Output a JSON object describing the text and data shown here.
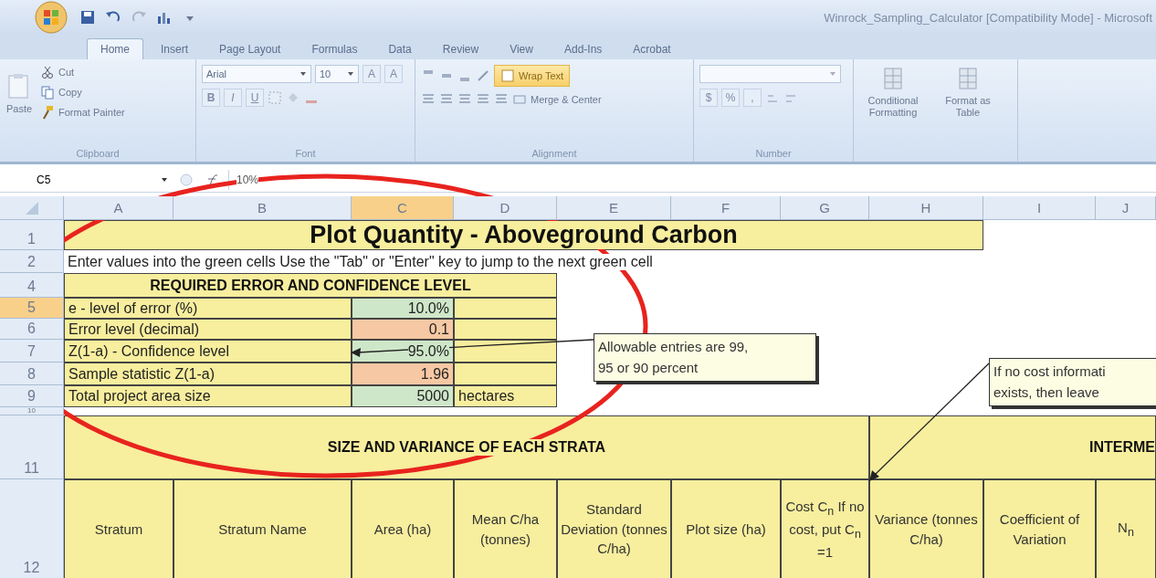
{
  "window": {
    "title": "Winrock_Sampling_Calculator  [Compatibility Mode] - Microsoft"
  },
  "ribbon_tabs": [
    {
      "label": "Home",
      "selected": true
    },
    {
      "label": "Insert",
      "selected": false
    },
    {
      "label": "Page Layout",
      "selected": false
    },
    {
      "label": "Formulas",
      "selected": false
    },
    {
      "label": "Data",
      "selected": false
    },
    {
      "label": "Review",
      "selected": false
    },
    {
      "label": "View",
      "selected": false
    },
    {
      "label": "Add-Ins",
      "selected": false
    },
    {
      "label": "Acrobat",
      "selected": false
    }
  ],
  "ribbon": {
    "clipboard": {
      "label": "Clipboard",
      "paste": "Paste",
      "items": [
        "Cut",
        "Copy",
        "Format Painter"
      ]
    },
    "font": {
      "label": "Font",
      "name": "Arial",
      "size": "10",
      "size_buttons": [
        "A",
        "A"
      ],
      "style_buttons": [
        "B",
        "I",
        "U"
      ]
    },
    "alignment": {
      "label": "Alignment",
      "wrap": "Wrap Text",
      "merge": "Merge & Center"
    },
    "number": {
      "label": "Number",
      "buttons": [
        "$",
        "%",
        ","
      ]
    },
    "styles": [
      "Conditional Formatting",
      "Format as Table"
    ]
  },
  "formula_bar": {
    "name_box": "C5",
    "formula": "10%"
  },
  "columns": [
    {
      "label": "A",
      "selected": false
    },
    {
      "label": "B",
      "selected": false
    },
    {
      "label": "C",
      "selected": true
    },
    {
      "label": "D",
      "selected": false
    },
    {
      "label": "E",
      "selected": false
    },
    {
      "label": "F",
      "selected": false
    },
    {
      "label": "G",
      "selected": false
    },
    {
      "label": "H",
      "selected": false
    },
    {
      "label": "I",
      "selected": false
    },
    {
      "label": "J",
      "selected": false
    }
  ],
  "rows": [
    {
      "kind": "title",
      "header": "1",
      "selected": false,
      "text": "Plot Quantity - Aboveground Carbon"
    },
    {
      "kind": "note",
      "header": "2",
      "selected": false,
      "text": "Enter values into the green cells  Use the \"Tab\" or \"Enter\" key to jump to the next green cell"
    },
    {
      "kind": "section",
      "header": "4",
      "selected": false,
      "text": "REQUIRED ERROR AND CONFIDENCE LEVEL"
    },
    {
      "kind": "param",
      "header": "5",
      "selected": true,
      "label": "e - level of error (%)",
      "value": "10.0%",
      "color": "#cfe7c9"
    },
    {
      "kind": "param",
      "header": "6",
      "selected": false,
      "label": "Error level (decimal)",
      "value": "0.1",
      "color": "#f6c8a4"
    },
    {
      "kind": "param",
      "header": "7",
      "selected": false,
      "label": "Z(1-a) - Confidence level",
      "value": "95.0%",
      "color": "#cfe7c9"
    },
    {
      "kind": "param",
      "header": "8",
      "selected": false,
      "label": "Sample statistic Z(1-a)",
      "value": "1.96",
      "color": "#f6c8a4"
    },
    {
      "kind": "param",
      "header": "9",
      "selected": false,
      "label": "Total project area size",
      "value": "5000",
      "unit": "hectares",
      "color": "#cfe7c9"
    },
    {
      "kind": "spacer",
      "header": "10",
      "selected": false
    },
    {
      "kind": "group",
      "header": "11",
      "selected": false,
      "texts": [
        "SIZE AND VARIANCE OF EACH STRATA",
        "INTERME"
      ]
    },
    {
      "kind": "columns",
      "header": "12",
      "selected": false,
      "cells": [
        "Stratum",
        "Stratum Name",
        "Area (ha)",
        "Mean C/ha (tonnes)",
        "Standard Deviation (tonnes C/ha)",
        "Plot size (ha)",
        "Cost C$_{n}$ If no cost, put C$_{n}$ =1",
        "Variance (tonnes C/ha)",
        "Coefficient of Variation",
        "N$_{n}$"
      ]
    }
  ],
  "comments": [
    {
      "lines": [
        "Allowable entries are 99,",
        "95 or 90 percent"
      ]
    },
    {
      "lines": [
        "If no cost informati",
        "exists, then leave"
      ]
    }
  ]
}
